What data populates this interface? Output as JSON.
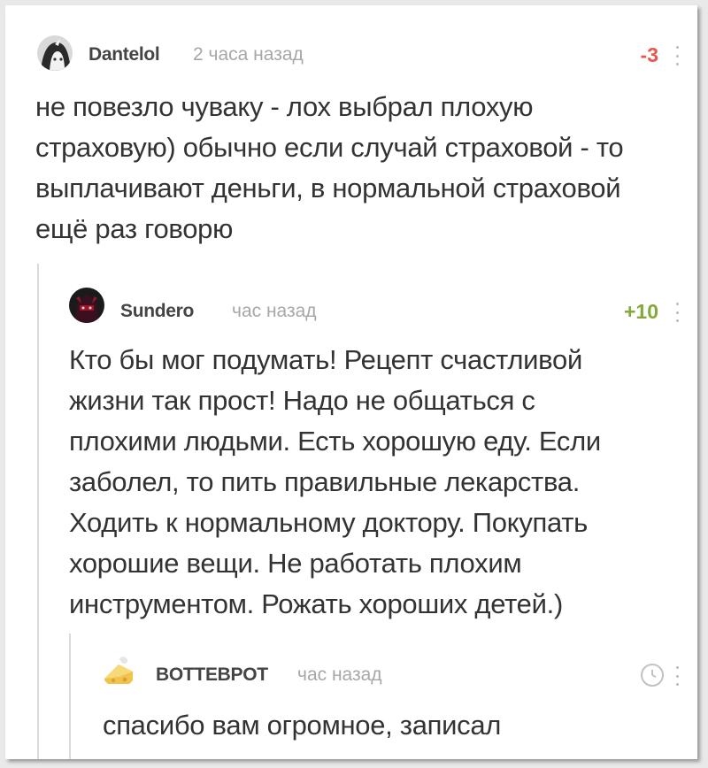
{
  "colors": {
    "negative_rating": "#e8574c",
    "positive_rating": "#84a83a",
    "muted": "#a7a7a7"
  },
  "comments": [
    {
      "author": "Dantelol",
      "time": "2 часа назад",
      "rating": "-3",
      "avatar_icon": "anime-avatar-icon",
      "text_lines": [
        "не повезло чуваку - лох выбрал плохую",
        "страховую) обычно если случай страховой - то",
        "выплачивают деньги, в нормальной страховой",
        "ещё раз говорю"
      ]
    },
    {
      "author": "Sundero",
      "time": "час назад",
      "rating": "+10",
      "avatar_icon": "dark-character-avatar-icon",
      "text_lines": [
        "Кто бы мог подумать! Рецепт счастливой",
        "жизни так прост! Надо не общаться с",
        "плохими людьми. Есть хорошую еду. Если",
        "заболел, то пить правильные лекарства.",
        "Ходить к нормальному доктору. Покупать",
        "хорошие вещи. Не работать плохим",
        "инструментом. Рожать хороших детей.)"
      ]
    },
    {
      "author": "BOTTEBPOT",
      "time": "час назад",
      "rating_icon": "clock-icon",
      "avatar_icon": "cheese-avatar-icon",
      "text_lines": [
        "спасибо вам огромное, записал"
      ]
    }
  ]
}
